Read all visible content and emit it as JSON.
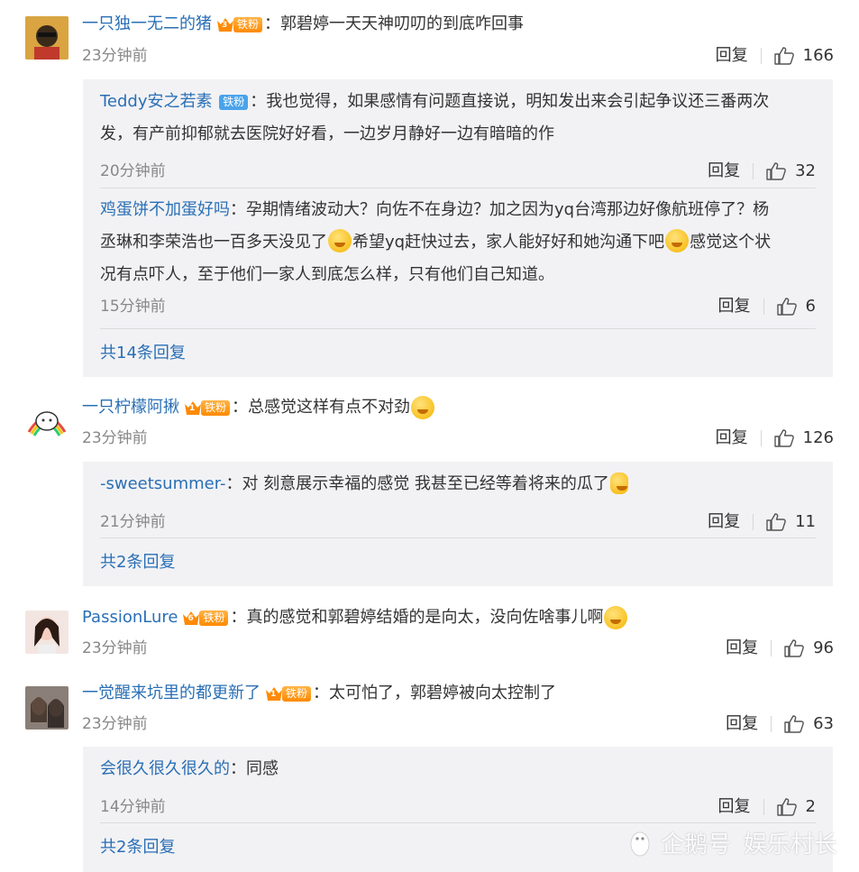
{
  "comments": [
    {
      "user": "一只独一无二的猪",
      "badge_level": "3",
      "badge_text": "铁粉",
      "text": "郭碧婷一天天神叨叨的到底咋回事",
      "time": "23分钟前",
      "reply_label": "回复",
      "likes": "166",
      "replies": [
        {
          "user": "Teddy安之若素",
          "badge_text": "铁粉",
          "text_line1": "我也觉得，如果感情有问题直接说，明知发出来会引起争议还三番两次",
          "text_line2": "发，有产前抑郁就去医院好好看，一边岁月静好一边有暗暗的作",
          "time": "20分钟前",
          "reply_label": "回复",
          "likes": "32"
        },
        {
          "user": "鸡蛋饼不加蛋好吗",
          "text_line1": "孕期情绪波动大？向佐不在身边？加之因为yq台湾那边好像航班停了？杨",
          "text_line2a": "丞琳和李荣浩也一百多天没见了",
          "text_line2b": "希望yq赶快过去，家人能好好和她沟通下吧",
          "text_line2c": "感觉这个状",
          "text_line3": "况有点吓人，至于他们一家人到底怎么样，只有他们自己知道。",
          "time": "15分钟前",
          "reply_label": "回复",
          "likes": "6"
        }
      ],
      "more_replies": "共14条回复"
    },
    {
      "user": "一只柠檬阿揪",
      "badge_level": "1",
      "badge_text": "铁粉",
      "text": "总感觉这样有点不对劲",
      "time": "23分钟前",
      "reply_label": "回复",
      "likes": "126",
      "replies": [
        {
          "user": "-sweetsummer-",
          "text": "对 刻意展示幸福的感觉 我甚至已经等着将来的瓜了",
          "time": "21分钟前",
          "reply_label": "回复",
          "likes": "11"
        }
      ],
      "more_replies": "共2条回复"
    },
    {
      "user": "PassionLure",
      "badge_level": "6",
      "badge_text": "铁粉",
      "text": "真的感觉和郭碧婷结婚的是向太，没向佐啥事儿啊",
      "time": "23分钟前",
      "reply_label": "回复",
      "likes": "96"
    },
    {
      "user": "一觉醒来坑里的都更新了",
      "badge_level": "1",
      "badge_text": "铁粉",
      "text": "太可怕了，郭碧婷被向太控制了",
      "time": "23分钟前",
      "reply_label": "回复",
      "likes": "63",
      "replies": [
        {
          "user": "会很久很久很久的",
          "text": "同感",
          "time": "14分钟前",
          "reply_label": "回复",
          "likes": "2"
        }
      ],
      "more_replies": "共2条回复"
    }
  ],
  "colon": "：",
  "watermark": {
    "brand": "企鹅号",
    "author": "娱乐村长"
  },
  "colors": {
    "link": "#2a6fb5",
    "reply_bg": "#f2f2f5",
    "badge_orange": "#ff8a00",
    "badge_blue": "#4aa3ea"
  }
}
